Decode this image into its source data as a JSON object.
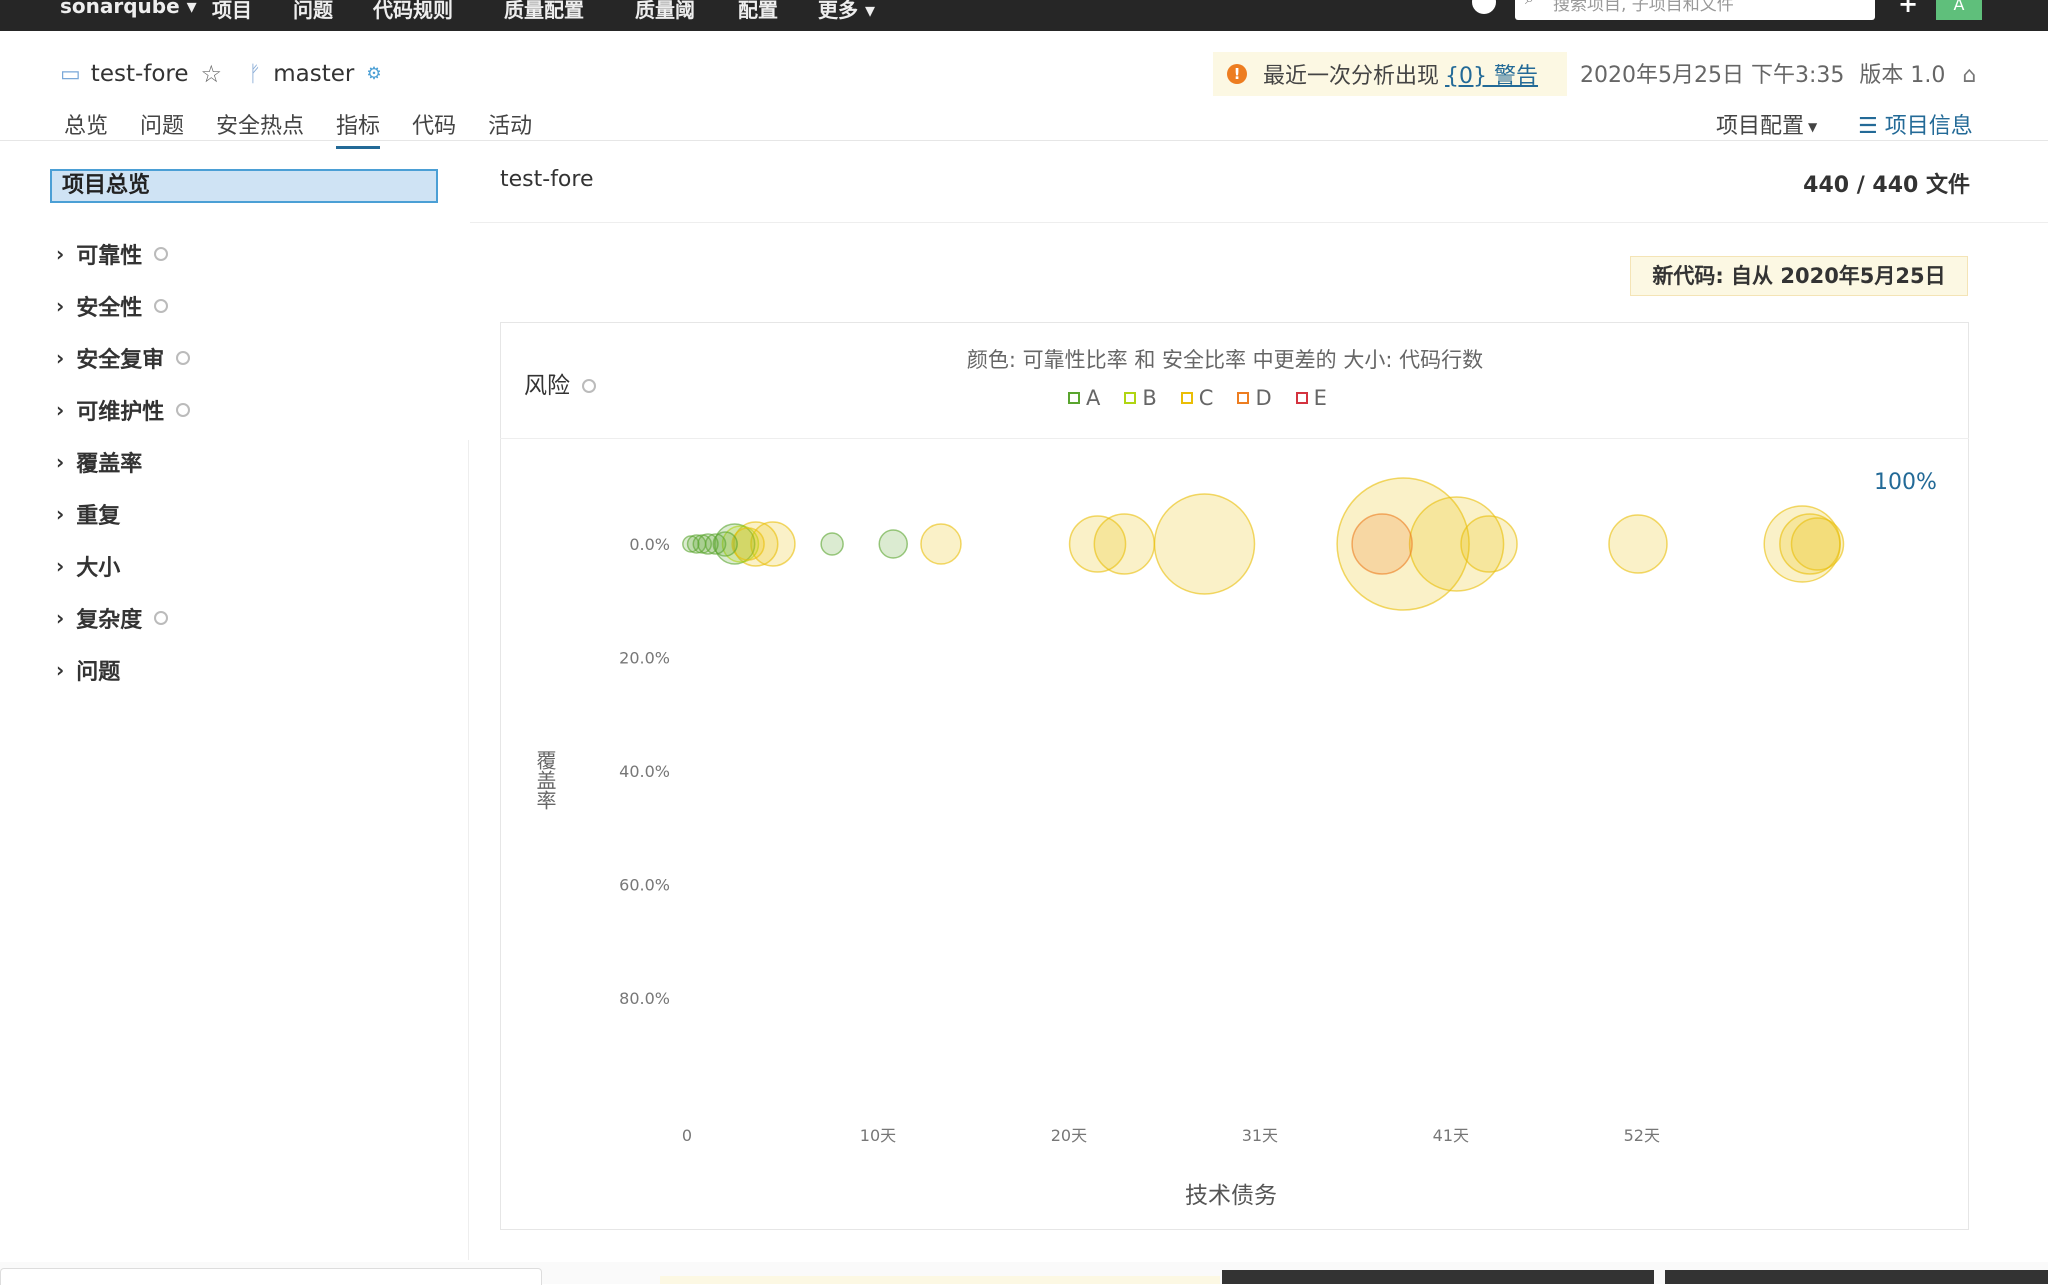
{
  "topbar": {
    "nav": [
      "项目",
      "问题",
      "代码规则",
      "质量配置",
      "质量阈",
      "配置",
      "更多"
    ],
    "search_placeholder": "搜索项目, 子项目和文件",
    "avatar_initial": "A"
  },
  "project": {
    "name": "test-fore",
    "branch": "master"
  },
  "warning": {
    "text": "最近一次分析出现",
    "link": "{0} 警告"
  },
  "analysis": {
    "date": "2020年5月25日 下午3:35",
    "version": "版本 1.0"
  },
  "tabs": [
    "总览",
    "问题",
    "安全热点",
    "指标",
    "代码",
    "活动"
  ],
  "active_tab": "指标",
  "header_right": {
    "config": "项目配置",
    "info": "项目信息"
  },
  "sidebar": {
    "overview": "项目总览",
    "items": [
      {
        "label": "可靠性",
        "help": true
      },
      {
        "label": "安全性",
        "help": true
      },
      {
        "label": "安全复审",
        "help": true
      },
      {
        "label": "可维护性",
        "help": true
      },
      {
        "label": "覆盖率",
        "help": false
      },
      {
        "label": "重复",
        "help": false
      },
      {
        "label": "大小",
        "help": false
      },
      {
        "label": "复杂度",
        "help": true
      },
      {
        "label": "问题",
        "help": false
      }
    ]
  },
  "main": {
    "component": "test-fore",
    "file_count": "440 / 440 文件",
    "new_code": "新代码: 自从 2020年5月25日"
  },
  "chart_data": {
    "type": "scatter",
    "title": "风险",
    "subtitle": "颜色: 可靠性比率 和 安全比率 中更差的 大小: 代码行数",
    "legend": [
      {
        "name": "A",
        "color": "#5aa52f"
      },
      {
        "name": "B",
        "color": "#b0d513"
      },
      {
        "name": "C",
        "color": "#eabe06"
      },
      {
        "name": "D",
        "color": "#ed7d20"
      },
      {
        "name": "E",
        "color": "#d4333f"
      }
    ],
    "legend_position": "top-center",
    "zoom_label": "100%",
    "xlabel": "技术债务",
    "ylabel": "覆盖率",
    "x_ticks": [
      "0",
      "10天",
      "20天",
      "31天",
      "41天",
      "52天"
    ],
    "y_ticks": [
      "0.0%",
      "20.0%",
      "40.0%",
      "60.0%",
      "80.0%"
    ],
    "y_inverted": true,
    "grid": false,
    "points": [
      {
        "x": 0.2,
        "y": 0,
        "size": 8,
        "rating": "A"
      },
      {
        "x": 0.5,
        "y": 0,
        "size": 9,
        "rating": "A"
      },
      {
        "x": 0.8,
        "y": 0,
        "size": 9,
        "rating": "A"
      },
      {
        "x": 1.1,
        "y": 0,
        "size": 10,
        "rating": "A"
      },
      {
        "x": 1.5,
        "y": 0,
        "size": 10,
        "rating": "A"
      },
      {
        "x": 2.0,
        "y": 0,
        "size": 12,
        "rating": "A"
      },
      {
        "x": 2.5,
        "y": 0,
        "size": 20,
        "rating": "A"
      },
      {
        "x": 2.8,
        "y": 0,
        "size": 18,
        "rating": "B"
      },
      {
        "x": 3.2,
        "y": 0,
        "size": 16,
        "rating": "C"
      },
      {
        "x": 3.6,
        "y": 0,
        "size": 22,
        "rating": "C"
      },
      {
        "x": 4.5,
        "y": 0,
        "size": 22,
        "rating": "C"
      },
      {
        "x": 7.6,
        "y": 0,
        "size": 11,
        "rating": "A"
      },
      {
        "x": 10.8,
        "y": 0,
        "size": 14,
        "rating": "A"
      },
      {
        "x": 13.3,
        "y": 0,
        "size": 20,
        "rating": "C"
      },
      {
        "x": 21.5,
        "y": 0,
        "size": 28,
        "rating": "C"
      },
      {
        "x": 22.9,
        "y": 0,
        "size": 30,
        "rating": "C"
      },
      {
        "x": 27.1,
        "y": 0,
        "size": 50,
        "rating": "C"
      },
      {
        "x": 37.5,
        "y": 0,
        "size": 66,
        "rating": "C"
      },
      {
        "x": 36.4,
        "y": 0,
        "size": 30,
        "rating": "D"
      },
      {
        "x": 40.3,
        "y": 0,
        "size": 47,
        "rating": "C"
      },
      {
        "x": 42.0,
        "y": 0,
        "size": 28,
        "rating": "C"
      },
      {
        "x": 49.8,
        "y": 0,
        "size": 29,
        "rating": "C"
      },
      {
        "x": 58.4,
        "y": 0,
        "size": 38,
        "rating": "C"
      },
      {
        "x": 58.8,
        "y": 0,
        "size": 30,
        "rating": "C"
      },
      {
        "x": 59.2,
        "y": 0,
        "size": 26,
        "rating": "C"
      }
    ]
  }
}
